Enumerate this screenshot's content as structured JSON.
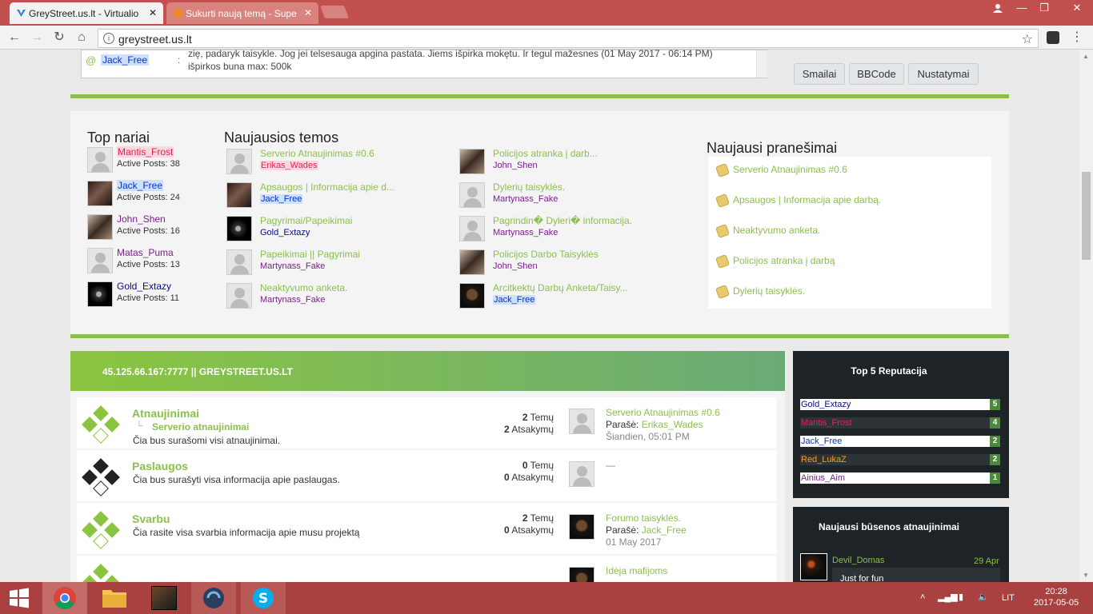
{
  "browser": {
    "tabs": [
      {
        "title": "GreyStreet.us.lt - Virtualio",
        "active": true
      },
      {
        "title": "Sukurti naują temą - Supe",
        "active": false
      }
    ],
    "url": "greystreet.us.lt"
  },
  "editor": {
    "mention_user": "Jack_Free",
    "text_line1": "zię, padaryk taisykle. Jog jei telsesauga apgina pastata. Jiems išpirka mokętu. Ir tegul mažesnes (01 May 2017 - 06:14 PM)",
    "text_line2": "išpirkos buna max: 500k",
    "buttons": [
      "Smailai",
      "BBCode",
      "Nustatymai"
    ]
  },
  "top_members": {
    "title": "Top nariai",
    "members": [
      {
        "name": "Mantis_Frost",
        "posts": "Active Posts: 38",
        "color": "#e0245e",
        "highlight": "#ffd6dc"
      },
      {
        "name": "Jack_Free",
        "posts": "Active Posts: 24",
        "color": "#0033cc",
        "highlight": "#cfe0ff"
      },
      {
        "name": "John_Shen",
        "posts": "Active Posts: 16",
        "color": "#7a1f8a",
        "highlight": ""
      },
      {
        "name": "Matas_Puma",
        "posts": "Active Posts: 13",
        "color": "#7a1f8a",
        "highlight": ""
      },
      {
        "name": "Gold_Extazy",
        "posts": "Active Posts: 11",
        "color": "#0a0a8a",
        "highlight": ""
      }
    ]
  },
  "latest_topics": {
    "title": "Naujausios temos",
    "col1": [
      {
        "title": "Serverio Atnaujinimas #0.6",
        "author": "Erikas_Wades",
        "color": "#e0245e",
        "highlight": "#ffd6dc"
      },
      {
        "title": "Apsaugos | Informacija apie d...",
        "author": "Jack_Free",
        "color": "#0033cc",
        "highlight": "#cfe0ff"
      },
      {
        "title": "Pagyrimai/Papeikimai",
        "author": "Gold_Extazy",
        "color": "#0a0a8a",
        "highlight": ""
      },
      {
        "title": "Papeikimai || Pagyrimai",
        "author": "Martynass_Fake",
        "color": "#7a1f8a",
        "highlight": ""
      },
      {
        "title": "Neaktyvumo anketa.",
        "author": "Martynass_Fake",
        "color": "#7a1f8a",
        "highlight": ""
      }
    ],
    "col2": [
      {
        "title": "Policijos atranka į darb...",
        "author": "John_Shen",
        "color": "#7a1f8a",
        "highlight": ""
      },
      {
        "title": "Dylerių taisyklės.",
        "author": "Martynass_Fake",
        "color": "#7a1f8a",
        "highlight": ""
      },
      {
        "title": "Pagrindin� Dyleri� informacija.",
        "author": "Martynass_Fake",
        "color": "#7a1f8a",
        "highlight": ""
      },
      {
        "title": "Policijos Darbo Taisyklės",
        "author": "John_Shen",
        "color": "#7a1f8a",
        "highlight": ""
      },
      {
        "title": "Arcitkektų Darbų Anketa/Taisy...",
        "author": "Jack_Free",
        "color": "#0033cc",
        "highlight": "#cfe0ff"
      }
    ]
  },
  "latest_posts": {
    "title": "Naujausi pranešimai",
    "items": [
      "Serverio Atnaujinimas #0.6",
      "Apsaugos | Informacija apie darbą.",
      "Neaktyvumo anketa.",
      "Policijos atranka į darbą",
      "Dylerių taisyklės."
    ]
  },
  "forum": {
    "header": "45.125.66.167:7777 || GREYSTREET.US.LT",
    "rows": [
      {
        "title": "Atnaujinimai",
        "subforum": "Serverio atnaujinimai",
        "desc": "Čia bus surašomi visi atnaujinimai.",
        "topics": "2",
        "replies": "2",
        "topics_label": "Temų",
        "replies_label": "Atsakymų",
        "last_title": "Serverio Atnaujinimas #0.6",
        "last_by_label": "Parašė:",
        "last_by": "Erikas_Wades",
        "last_date": "Šiandien, 05:01 PM"
      },
      {
        "title": "Paslaugos",
        "subforum": "",
        "desc": "Čia bus surašyti visa informacija apie paslaugas.",
        "topics": "0",
        "replies": "0",
        "topics_label": "Temų",
        "replies_label": "Atsakymų",
        "last_title": "—",
        "last_by_label": "",
        "last_by": "",
        "last_date": ""
      },
      {
        "title": "Svarbu",
        "subforum": "",
        "desc": "Čia rasite visa svarbia informacija apie musu projektą",
        "topics": "2",
        "replies": "0",
        "topics_label": "Temų",
        "replies_label": "Atsakymų",
        "last_title": "Forumo taisyklės.",
        "last_by_label": "Parašė:",
        "last_by": "Jack_Free",
        "last_date": "01 May 2017"
      },
      {
        "title": "",
        "subforum": "",
        "desc": "",
        "topics": "",
        "replies": "",
        "topics_label": "",
        "replies_label": "",
        "last_title": "Idėja mafijoms",
        "last_by_label": "",
        "last_by": "",
        "last_date": ""
      }
    ]
  },
  "reputation": {
    "title": "Top 5 Reputacija",
    "items": [
      {
        "name": "Gold_Extazy",
        "value": "5",
        "color": "#0a0a8a",
        "dark": false
      },
      {
        "name": "Mantis_Frost",
        "value": "4",
        "color": "#e0245e",
        "dark": true
      },
      {
        "name": "Jack_Free",
        "value": "2",
        "color": "#0033cc",
        "dark": false
      },
      {
        "name": "Red_LukaZ",
        "value": "2",
        "color": "#f0a020",
        "dark": true
      },
      {
        "name": "Ainius_Aim",
        "value": "1",
        "color": "#7a1f8a",
        "dark": false
      }
    ]
  },
  "status_updates": {
    "title": "Naujausi būsenos atnaujinimai",
    "items": [
      {
        "name": "Devil_Domas",
        "date": "29 Apr",
        "text": "Just for fun"
      }
    ]
  },
  "taskbar": {
    "time": "20:28",
    "date": "2017-05-05",
    "lang": "LIT"
  }
}
